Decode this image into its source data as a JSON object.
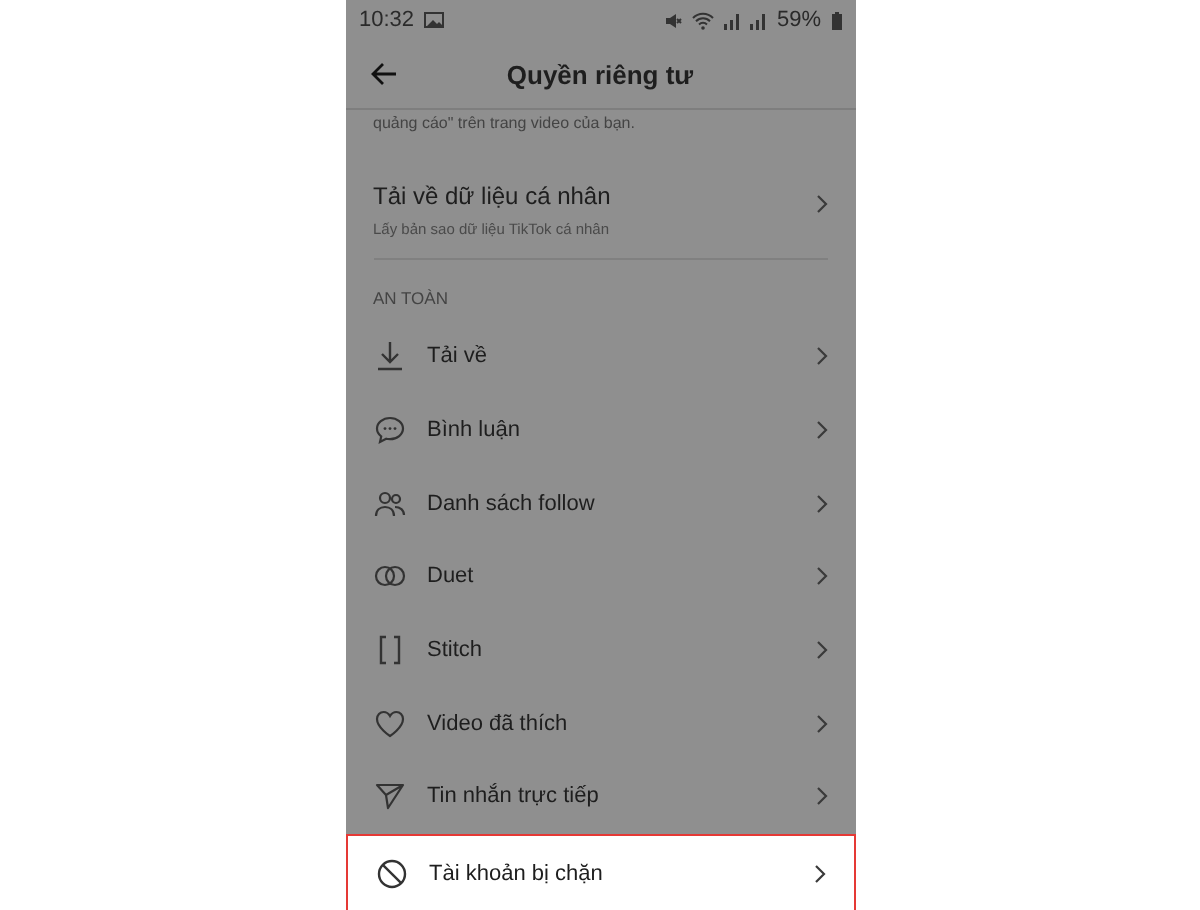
{
  "status_bar": {
    "time": "10:32",
    "battery": "59%"
  },
  "header": {
    "title": "Quyền riêng tư"
  },
  "partial_text": "quảng cáo\" trên trang video của bạn.",
  "data_row": {
    "label": "Tải về dữ liệu cá nhân",
    "description": "Lấy bản sao dữ liệu TikTok cá nhân"
  },
  "section": {
    "title": "AN TOÀN"
  },
  "items": [
    {
      "label": "Tải về",
      "highlighted": false
    },
    {
      "label": "Bình luận",
      "highlighted": false
    },
    {
      "label": "Danh sách follow",
      "highlighted": false
    },
    {
      "label": "Duet",
      "highlighted": false
    },
    {
      "label": "Stitch",
      "highlighted": false
    },
    {
      "label": "Video đã thích",
      "highlighted": false
    },
    {
      "label": "Tin nhắn trực tiếp",
      "highlighted": false
    },
    {
      "label": "Tài khoản bị chặn",
      "highlighted": true
    }
  ]
}
